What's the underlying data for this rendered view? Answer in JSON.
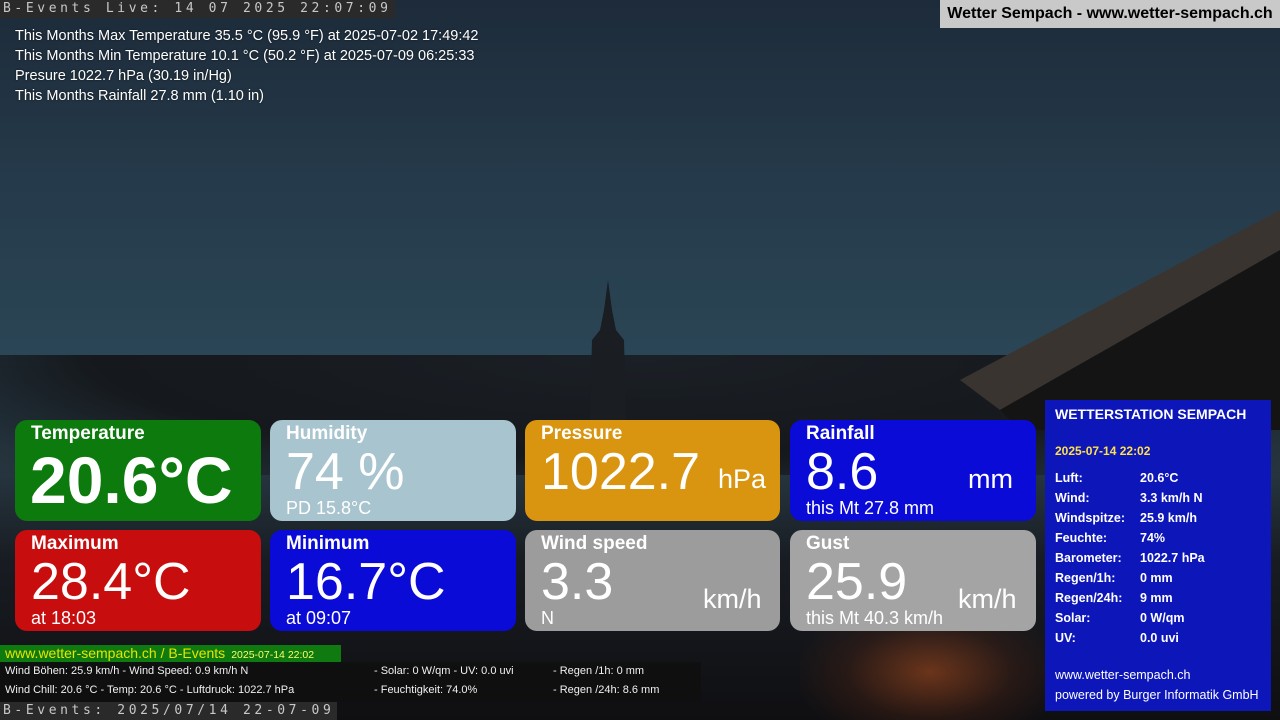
{
  "ticker_top": "B-Events Live: 14 07 2025 22:07:09",
  "ticker_bottom": "B-Events: 2025/07/14 22-07-09",
  "site_banner": "Wetter Sempach - www.wetter-sempach.ch",
  "stats": [
    "This Months Max Temperature 35.5 °C (95.9 °F) at 2025-07-02 17:49:42",
    "This Months Min Temperature 10.1 °C (50.2 °F) at 2025-07-09 06:25:33",
    "Presure 1022.7 hPa (30.19 in/Hg)",
    "This Months Rainfall 27.8 mm (1.10 in)"
  ],
  "tiles": {
    "temperature": {
      "title": "Temperature",
      "value": "20.6°C",
      "color": "#0d7a0d"
    },
    "humidity": {
      "title": "Humidity",
      "value": "74 %",
      "sub": "PD 15.8°C",
      "color": "#a8c4cf"
    },
    "pressure": {
      "title": "Pressure",
      "value": "1022.7",
      "unit": "hPa",
      "color": "#d99410"
    },
    "rainfall": {
      "title": "Rainfall",
      "value": "8.6",
      "unit": "mm",
      "sub": "this Mt 27.8 mm",
      "color": "#0b0bd8"
    },
    "maximum": {
      "title": "Maximum",
      "value": "28.4°C",
      "sub": "at 18:03",
      "color": "#c70d0d"
    },
    "minimum": {
      "title": "Minimum",
      "value": "16.7°C",
      "sub": "at 09:07",
      "color": "#0b0bd8"
    },
    "wind": {
      "title": "Wind speed",
      "value": "3.3",
      "unit": "km/h",
      "sub": "N",
      "color": "#9c9c9c"
    },
    "gust": {
      "title": "Gust",
      "value": "25.9",
      "unit": "km/h",
      "sub": "this Mt 40.3 km/h",
      "color": "#a4a4a4"
    }
  },
  "station": {
    "heading": "WETTERSTATION SEMPACH",
    "datetime": "2025-07-14 22:02",
    "rows": [
      {
        "k": "Luft:",
        "v": "20.6°C"
      },
      {
        "k": "Wind:",
        "v": "3.3 km/h  N"
      },
      {
        "k": "Windspitze:",
        "v": "25.9 km/h"
      },
      {
        "k": "Feuchte:",
        "v": "74%"
      },
      {
        "k": "Barometer:",
        "v": "1022.7 hPa"
      },
      {
        "k": "Regen/1h:",
        "v": "0 mm"
      },
      {
        "k": "Regen/24h:",
        "v": "9 mm"
      },
      {
        "k": "Solar:",
        "v": "0 W/qm"
      },
      {
        "k": "UV:",
        "v": "0.0 uvi"
      }
    ],
    "site": "www.wetter-sempach.ch",
    "powered": "powered by Burger Informatik GmbH"
  },
  "footer": {
    "link": "www.wetter-sempach.ch / B-Events",
    "date": "2025-07-14 22:02",
    "line1": {
      "a": "Wind Böhen: 25.9 km/h  - Wind Speed: 0.9 km/h N",
      "b": "- Solar: 0 W/qm   - UV: 0.0 uvi",
      "c": "- Regen /1h:   0 mm"
    },
    "line2": {
      "a": "Wind Chill: 20.6 °C         - Temp: 20.6 °C  - Luftdruck: 1022.7 hPa",
      "b": "- Feuchtigkeit: 74.0%",
      "c": "- Regen /24h: 8.6 mm"
    }
  }
}
